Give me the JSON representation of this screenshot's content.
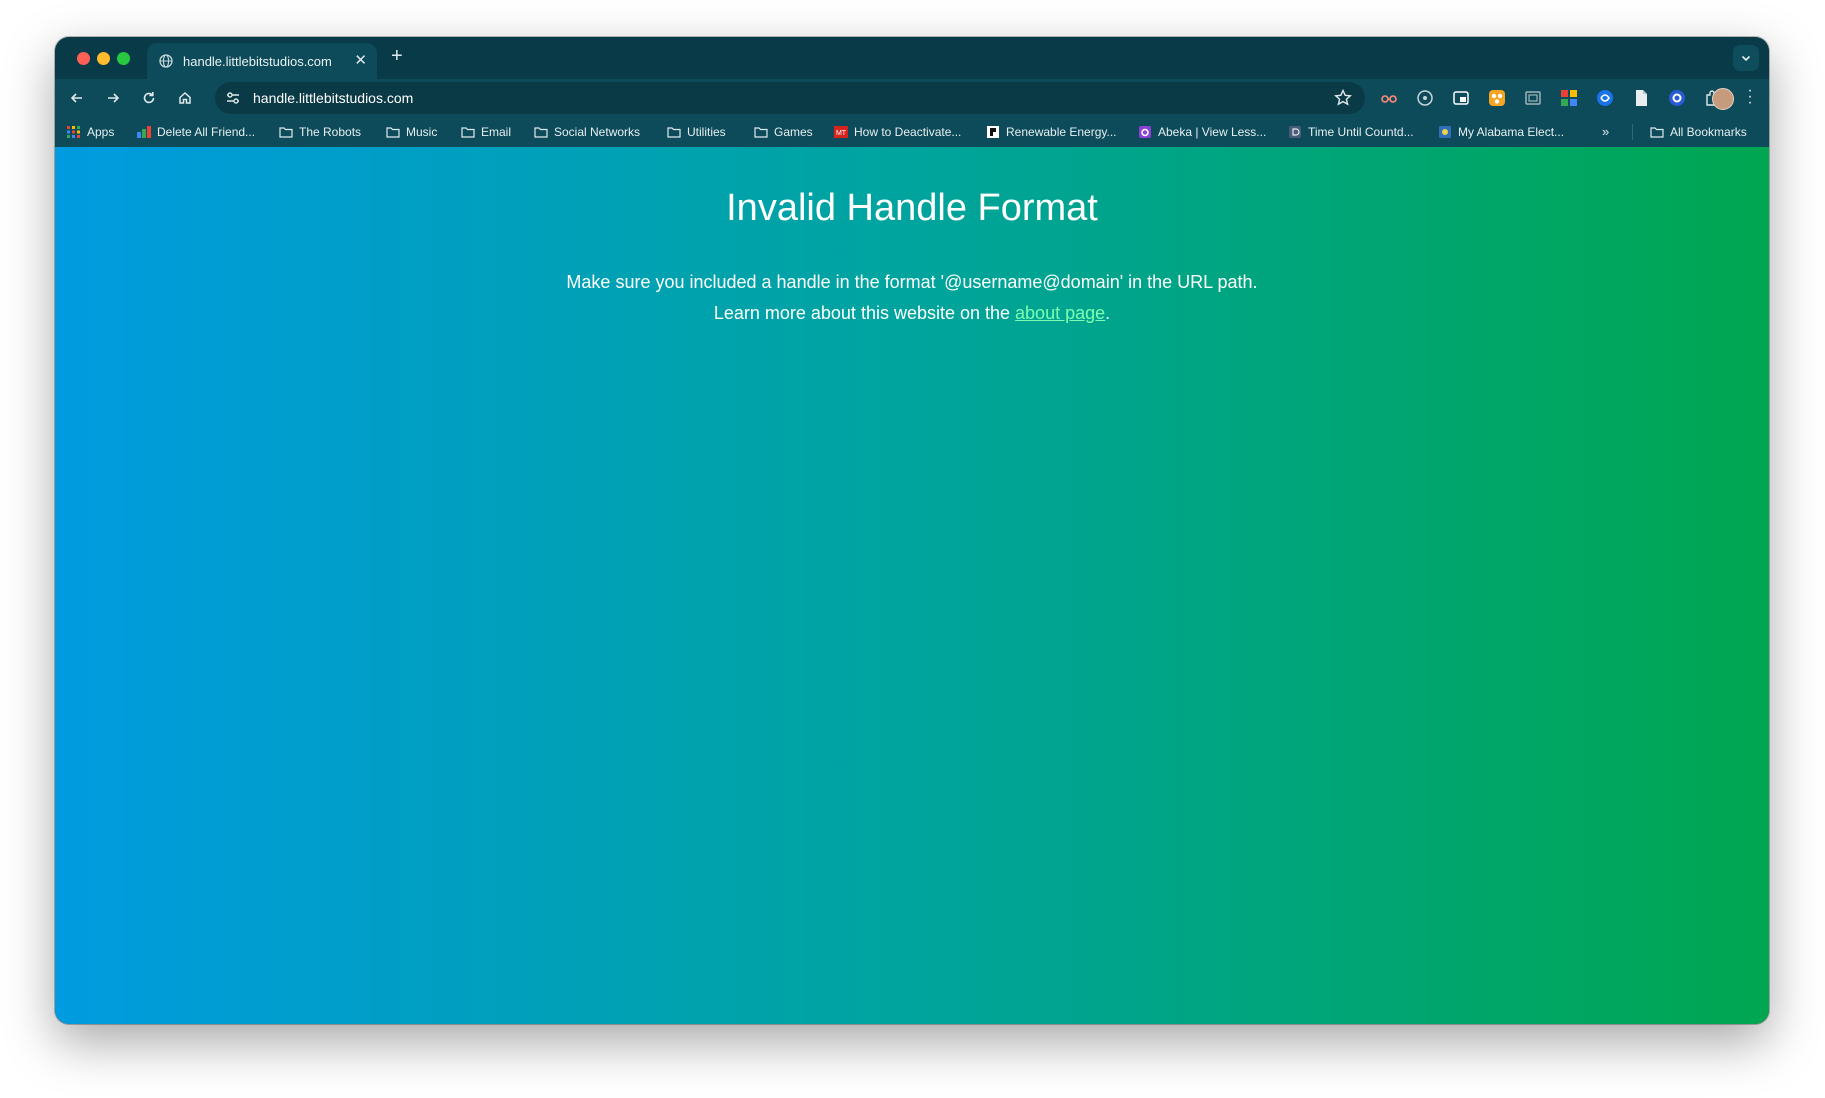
{
  "tab": {
    "title": "handle.littlebitstudios.com"
  },
  "omnibox": {
    "url": "handle.littlebitstudios.com"
  },
  "bookmarks": [
    {
      "label": "Apps",
      "icon": "apps-grid-icon"
    },
    {
      "label": "Delete All Friend...",
      "icon": "colorful-bookmark-icon"
    },
    {
      "label": "The Robots",
      "icon": "folder-icon"
    },
    {
      "label": "Music",
      "icon": "folder-icon"
    },
    {
      "label": "Email",
      "icon": "folder-icon"
    },
    {
      "label": "Social Networks",
      "icon": "folder-icon"
    },
    {
      "label": "Utilities",
      "icon": "folder-icon"
    },
    {
      "label": "Games",
      "icon": "folder-icon"
    },
    {
      "label": "How to Deactivate...",
      "icon": "mt-favicon-icon"
    },
    {
      "label": "Renewable Energy...",
      "icon": "renewable-favicon-icon"
    },
    {
      "label": "Abeka | View Less...",
      "icon": "abeka-favicon-icon"
    },
    {
      "label": "Time Until Countd...",
      "icon": "countdown-favicon-icon"
    },
    {
      "label": "My Alabama Elect...",
      "icon": "alabama-favicon-icon"
    }
  ],
  "bookmarks_all": {
    "label": "All Bookmarks"
  },
  "page": {
    "title": "Invalid Handle Format",
    "line1": "Make sure you included a handle in the format '@username@domain' in the URL path.",
    "line2_prefix": "Learn more about this website on the ",
    "link_text": "about page",
    "line2_suffix": "."
  },
  "colors": {
    "frame": "#093a47",
    "toolbar": "#0d4b5a",
    "gradient_start": "#009be0",
    "gradient_end": "#00a650",
    "link": "#7dffb0"
  }
}
